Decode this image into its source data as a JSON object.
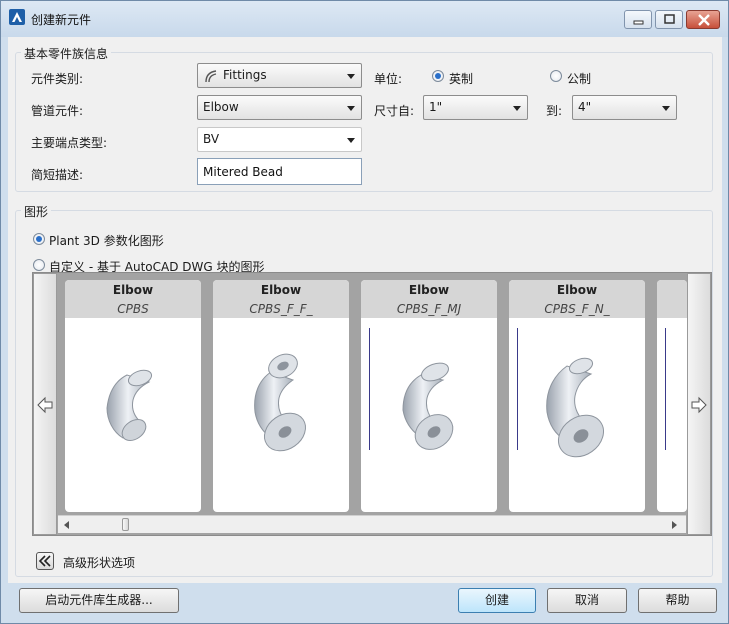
{
  "window": {
    "title": "创建新元件",
    "buttons": [
      "minimize",
      "maximize",
      "close"
    ]
  },
  "basic_info": {
    "group_title": "基本零件族信息",
    "class_label": "元件类别:",
    "class_value": "Fittings",
    "unit_label": "单位:",
    "unit_options": [
      "英制",
      "公制"
    ],
    "unit_selected": "英制",
    "component_label": "管道元件:",
    "component_value": "Elbow",
    "size_from_label": "尺寸自:",
    "size_from_value": "1\"",
    "size_to_label": "到:",
    "size_to_value": "4\"",
    "end_type_label": "主要端点类型:",
    "end_type_value": "BV",
    "desc_label": "简短描述:",
    "desc_value": "Mitered Bead"
  },
  "graphics": {
    "group_title": "图形",
    "option_parametric": "Plant 3D 参数化图形",
    "option_custom": "自定义 - 基于 AutoCAD DWG 块的图形",
    "selected": "Plant 3D 参数化图形",
    "cards": [
      {
        "name": "Elbow",
        "code": "CPBS"
      },
      {
        "name": "Elbow",
        "code": "CPBS_F_F_"
      },
      {
        "name": "Elbow",
        "code": "CPBS_F_MJ"
      },
      {
        "name": "Elbow",
        "code": "CPBS_F_N_"
      }
    ],
    "advanced_label": "高级形状选项"
  },
  "footer": {
    "launch_builder": "启动元件库生成器...",
    "create": "创建",
    "cancel": "取消",
    "help": "帮助"
  },
  "colors": {
    "title_bg": "#cfdeed",
    "accent": "#2a6fc9",
    "gallery_bg": "#a3a3a3"
  }
}
